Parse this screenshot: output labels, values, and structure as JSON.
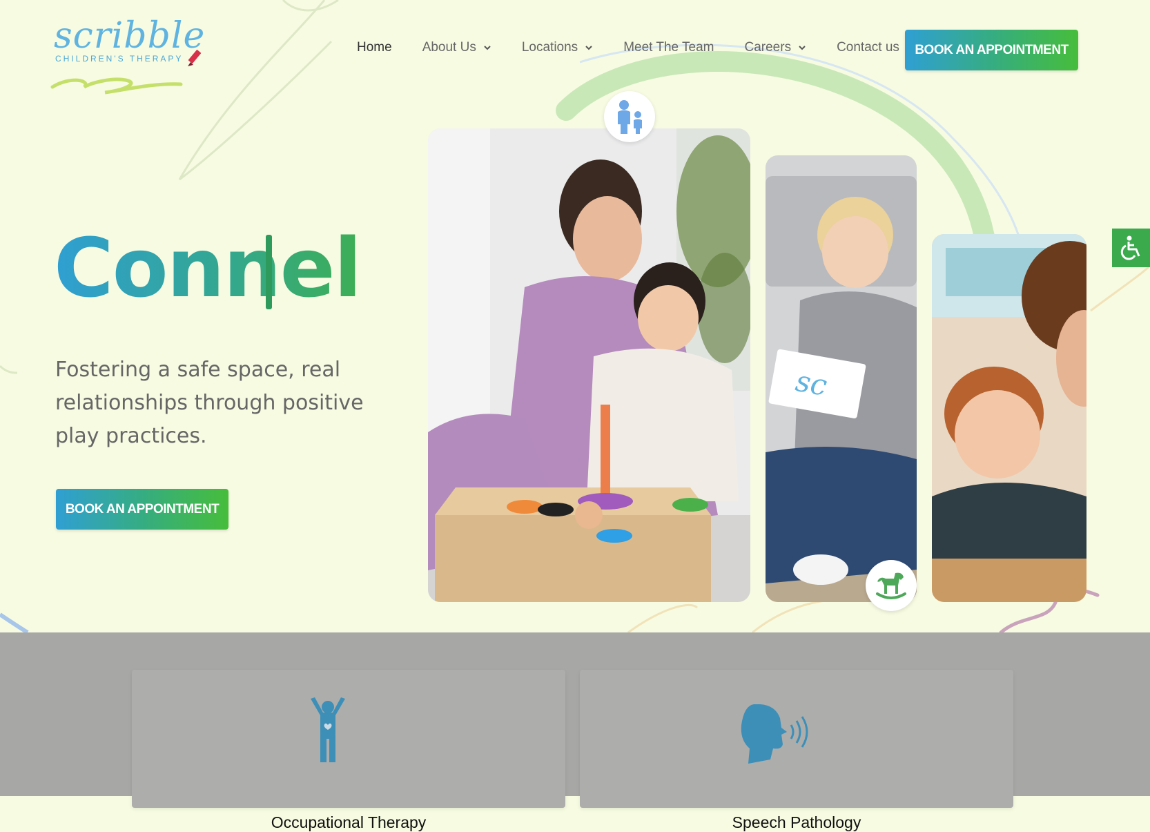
{
  "header": {
    "logo": {
      "word": "scribble",
      "subtitle": "CHILDREN'S THERAPY"
    },
    "nav": [
      {
        "label": "Home",
        "has_dropdown": false,
        "active": true
      },
      {
        "label": "About Us",
        "has_dropdown": true,
        "active": false
      },
      {
        "label": "Locations",
        "has_dropdown": true,
        "active": false
      },
      {
        "label": "Meet The Team",
        "has_dropdown": false,
        "active": false
      },
      {
        "label": "Careers",
        "has_dropdown": true,
        "active": false
      },
      {
        "label": "Contact us",
        "has_dropdown": false,
        "active": false
      }
    ],
    "cta_label": "BOOK AN APPOINTMENT"
  },
  "hero": {
    "headline": "Connel",
    "subtitle": "Fostering a safe space, real relationships through positive play practices.",
    "cta_label": "BOOK AN APPOINTMENT",
    "photo_card_text": "sc"
  },
  "services": [
    {
      "title": "Occupational Therapy",
      "icon": "person-raised-arms-icon"
    },
    {
      "title": "Speech Pathology",
      "icon": "speaking-head-icon"
    }
  ],
  "colors": {
    "background": "#f7fbe2",
    "gradient_start": "#2f9fd3",
    "gradient_end": "#47bd3b",
    "accessibility": "#3aaa4d",
    "icon_blue": "#3d8fb8",
    "overlay_grey": "#a7a7a5"
  }
}
